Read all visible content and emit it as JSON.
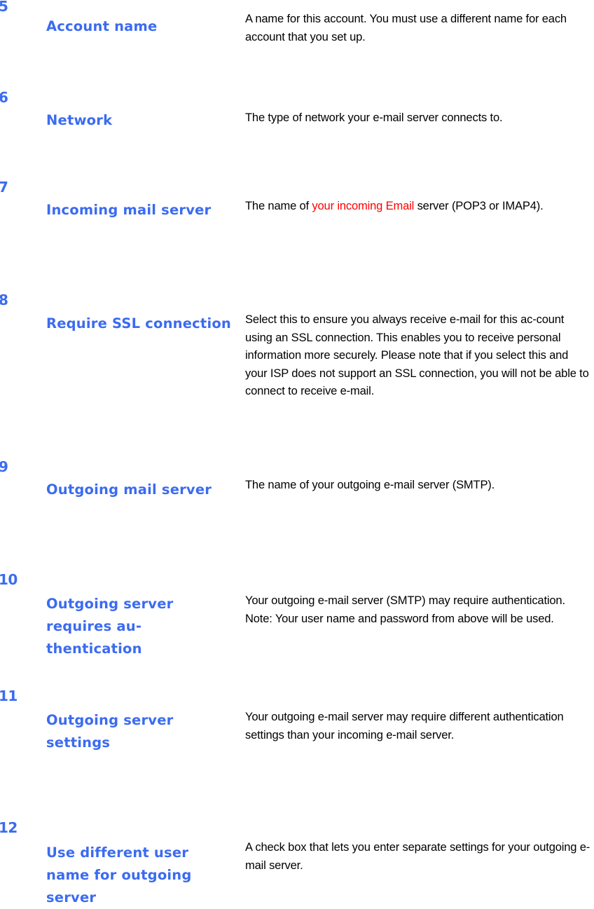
{
  "document": {
    "type": "field-reference-table",
    "colors": {
      "term": "#3B6BF0",
      "number": "#3B6BF0",
      "description": "#000000",
      "highlight": "#FF0000",
      "background": "#FFFFFF"
    },
    "columns": {
      "number_header": "",
      "term_header": "",
      "description_header": ""
    }
  },
  "rows": [
    {
      "number": "5",
      "label": "Account name",
      "description_plain": "A name for this account. You must use a different name for each account that you set up.",
      "description_parts": [
        {
          "text": "A name for this account. You must use a different name for each account that you set up.",
          "color": "black"
        }
      ]
    },
    {
      "number": "6",
      "label": "Network",
      "description_plain": "The type of network your e-mail server connects to.",
      "description_parts": [
        {
          "text": "The type of network your e-mail server connects to.",
          "color": "black"
        }
      ]
    },
    {
      "number": "7",
      "label": "Incoming mail server",
      "description_plain": "The name of your incoming Email server (POP3 or IMAP4).",
      "description_parts": [
        {
          "text": "The name of ",
          "color": "black"
        },
        {
          "text": "your incoming Email",
          "color": "red"
        },
        {
          "text": " server (POP3 or IMAP4).",
          "color": "black"
        }
      ]
    },
    {
      "number": "8",
      "label": "Require SSL connection",
      "description_plain": "Select this to ensure you always receive e-mail for this ac-count using an SSL connection. This enables you to receive personal information more securely. Please note that if you select this and your ISP does not support an SSL connection, you will not be able to connect to receive e-mail.",
      "description_parts": [
        {
          "text": "Select this to ensure you always receive e-mail for this ac-count using an SSL connection. This enables you to receive personal information more securely. Please note that if you select this and your ISP does not support an SSL connection, you will not be able to connect to receive e-mail.",
          "color": "black"
        }
      ]
    },
    {
      "number": "9",
      "label": "Outgoing mail server",
      "description_plain": "The name of your outgoing e-mail server (SMTP).",
      "description_parts": [
        {
          "text": "The name of your outgoing e-mail server (SMTP).",
          "color": "black"
        }
      ]
    },
    {
      "number": "10",
      "label": "Outgoing server requires au-thentication",
      "description_plain": "Your outgoing e-mail server (SMTP) may require authentication. Note: Your user name and password from above will be used.",
      "description_parts": [
        {
          "text": "Your outgoing e-mail server (SMTP) may require authentication. Note: Your user name and password from above will be used.",
          "color": "black"
        }
      ]
    },
    {
      "number": "11",
      "label": "Outgoing server settings",
      "description_plain": "Your outgoing e-mail server may require different authentication settings than your incoming e-mail server.",
      "description_parts": [
        {
          "text": "Your outgoing e-mail server may require different authentication settings than your incoming e-mail server.",
          "color": "black"
        }
      ]
    },
    {
      "number": "12",
      "label": "Use different user name for outgoing server",
      "description_plain": "A check box that lets you enter separate settings for your outgoing e-mail server.",
      "description_parts": [
        {
          "text": "A check box that lets you enter separate settings for your outgoing e-mail server.",
          "color": "black"
        }
      ]
    }
  ]
}
